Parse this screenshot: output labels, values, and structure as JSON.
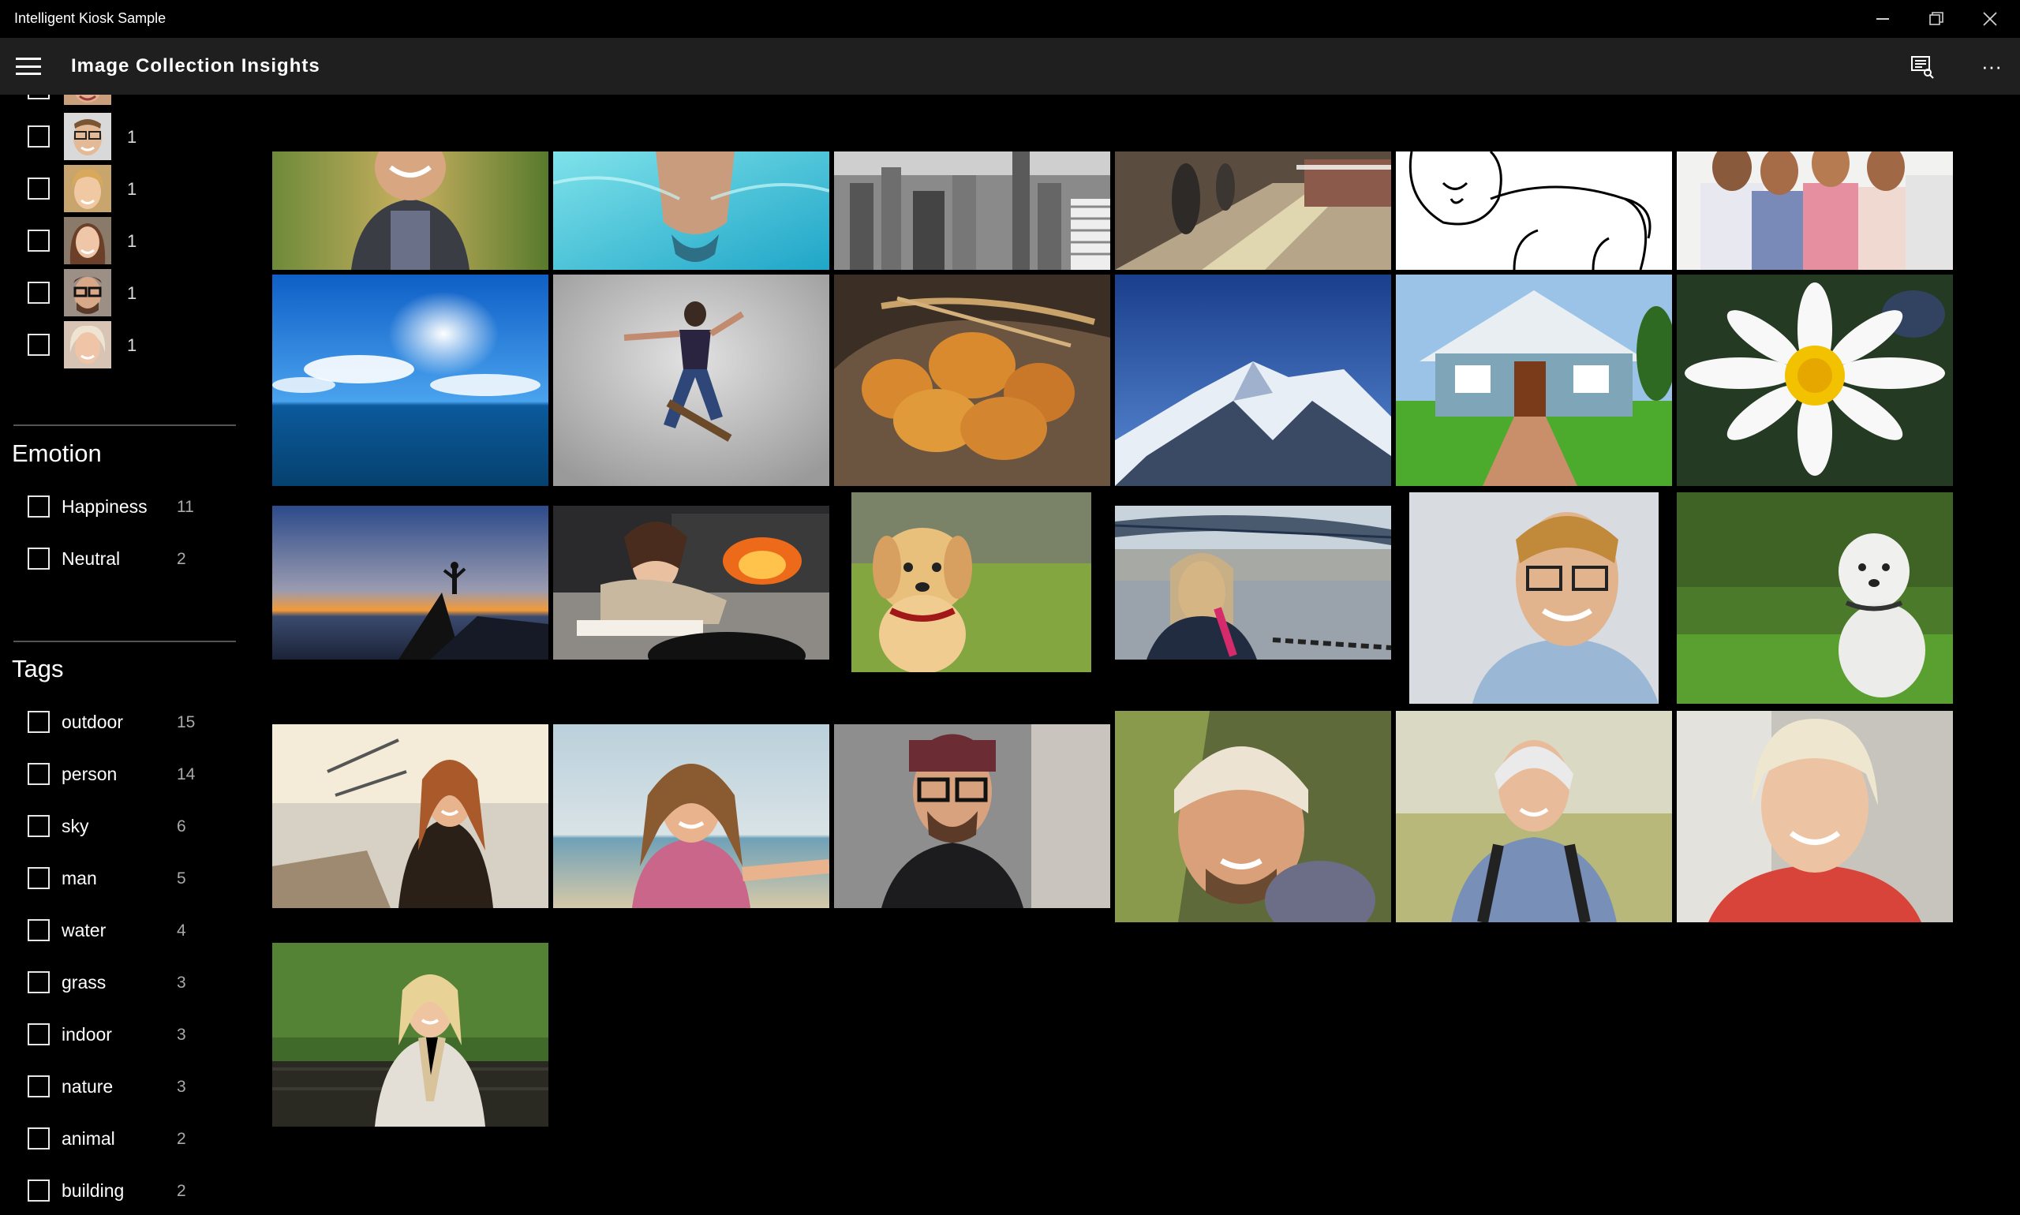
{
  "window": {
    "app_title": "Intelligent Kiosk Sample",
    "minimize_icon": "minimize-icon",
    "restore_icon": "restore-icon",
    "close_icon": "close-icon"
  },
  "header": {
    "title": "Image Collection Insights",
    "menu_icon": "hamburger-icon",
    "feedback_icon": "feedback-icon",
    "more_label": "···"
  },
  "faces": {
    "items": [
      {
        "count": "1"
      },
      {
        "count": "1"
      },
      {
        "count": "1"
      },
      {
        "count": "1"
      },
      {
        "count": "1"
      }
    ]
  },
  "emotion": {
    "title": "Emotion",
    "items": [
      {
        "label": "Happiness",
        "count": "11"
      },
      {
        "label": "Neutral",
        "count": "2"
      }
    ]
  },
  "tags": {
    "title": "Tags",
    "items": [
      {
        "label": "outdoor",
        "count": "15"
      },
      {
        "label": "person",
        "count": "14"
      },
      {
        "label": "sky",
        "count": "6"
      },
      {
        "label": "man",
        "count": "5"
      },
      {
        "label": "water",
        "count": "4"
      },
      {
        "label": "grass",
        "count": "3"
      },
      {
        "label": "indoor",
        "count": "3"
      },
      {
        "label": "nature",
        "count": "3"
      },
      {
        "label": "animal",
        "count": "2"
      },
      {
        "label": "building",
        "count": "2"
      }
    ]
  },
  "gallery": {
    "images": [
      {
        "subject": "smiling-man-jacket"
      },
      {
        "subject": "swimmer-pool"
      },
      {
        "subject": "city-skyline-bw"
      },
      {
        "subject": "subway-platform"
      },
      {
        "subject": "lion-drawing"
      },
      {
        "subject": "family-group"
      },
      {
        "subject": "ocean-sky"
      },
      {
        "subject": "skateboarder"
      },
      {
        "subject": "bread-buns"
      },
      {
        "subject": "snowy-mountain"
      },
      {
        "subject": "blue-house"
      },
      {
        "subject": "daisy-flower"
      },
      {
        "subject": "sunset-hiker"
      },
      {
        "subject": "woman-reading-fireplace"
      },
      {
        "subject": "golden-puppy"
      },
      {
        "subject": "woman-bridge-river"
      },
      {
        "subject": "man-glasses-portrait"
      },
      {
        "subject": "white-dog-grass"
      },
      {
        "subject": "woman-sunlight"
      },
      {
        "subject": "woman-beach-selfie"
      },
      {
        "subject": "man-beanie-glasses"
      },
      {
        "subject": "man-knit-hat"
      },
      {
        "subject": "senior-woman-backpack"
      },
      {
        "subject": "senior-woman-smiling"
      },
      {
        "subject": "blonde-woman-park"
      }
    ]
  }
}
